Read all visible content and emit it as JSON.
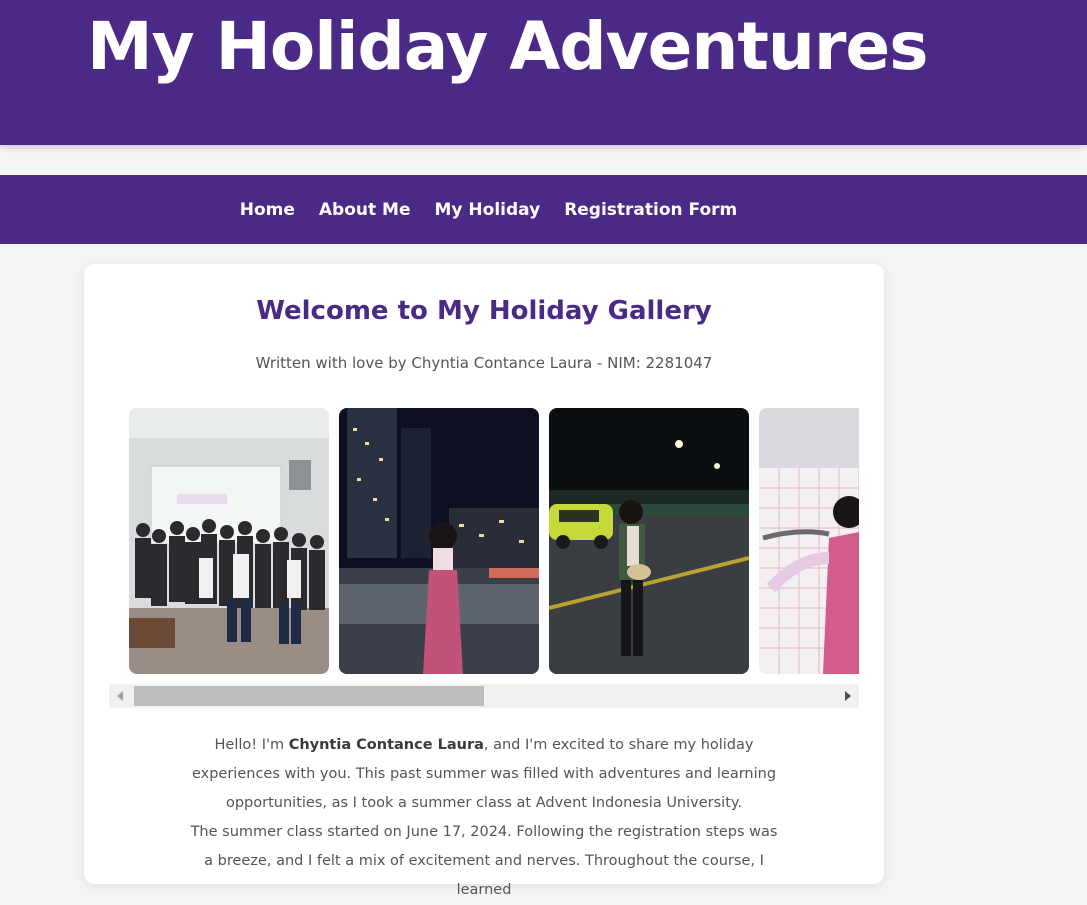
{
  "header": {
    "title": "My Holiday Adventures"
  },
  "nav": {
    "items": [
      {
        "label": "Home"
      },
      {
        "label": "About Me"
      },
      {
        "label": "My Holiday"
      },
      {
        "label": "Registration Form"
      }
    ]
  },
  "main": {
    "heading": "Welcome to My Holiday Gallery",
    "subtitle": "Written with love by Chyntia Contance Laura - NIM: 2281047",
    "gallery": {
      "photos": [
        {
          "icon": "group-photo-classroom"
        },
        {
          "icon": "night-city-portrait"
        },
        {
          "icon": "night-street-portrait"
        },
        {
          "icon": "tiled-wall-portrait"
        }
      ]
    },
    "intro": {
      "p1_pre": "Hello! I'm ",
      "p1_name": "Chyntia Contance Laura",
      "p1_post": ", and I'm excited to share my holiday experiences with you. This past summer was filled with adventures and learning opportunities, as I took a summer class at Advent Indonesia University.",
      "p2": "The summer class started on June 17, 2024. Following the registration steps was a breeze, and I felt a mix of excitement and nerves. Throughout the course, I learned"
    }
  },
  "colors": {
    "brand": "#4b2a87",
    "background": "#f4f3f6",
    "text": "#555555"
  }
}
